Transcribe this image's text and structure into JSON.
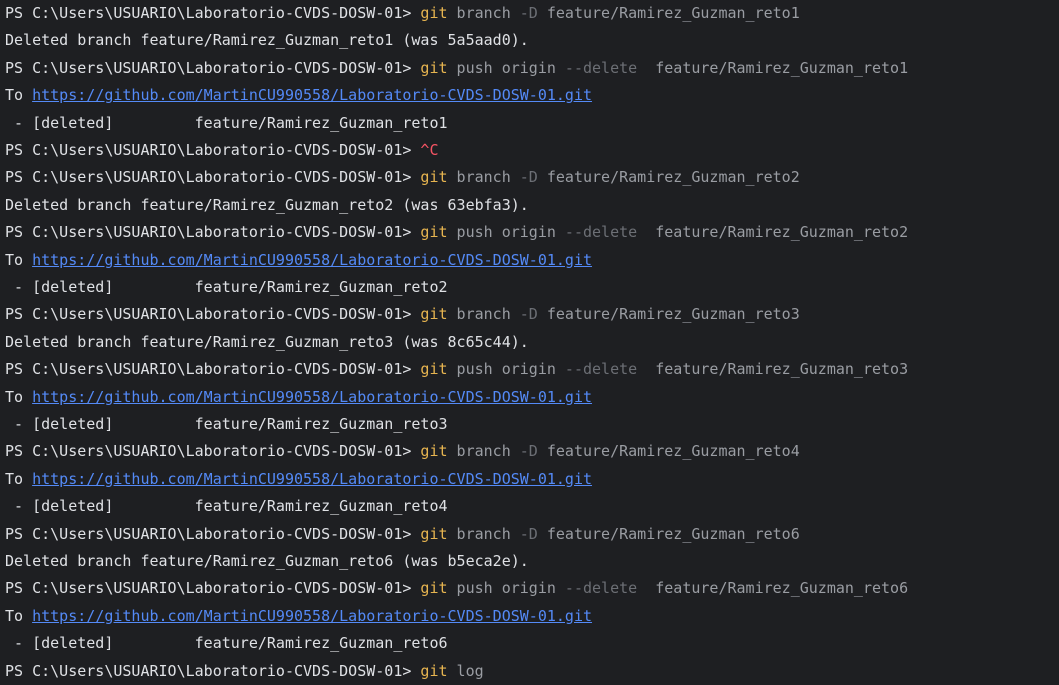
{
  "prompt": "PS C:\\Users\\USUARIO\\Laboratorio-CVDS-DOSW-01> ",
  "lines": [
    {
      "kind": "cmd",
      "cmd": "git",
      "args": [
        {
          "t": " branch ",
          "c": "arg"
        },
        {
          "t": "-D",
          "c": "flag"
        },
        {
          "t": " feature/Ramirez_Guzman_reto1",
          "c": "arg"
        }
      ]
    },
    {
      "kind": "out",
      "text": "Deleted branch feature/Ramirez_Guzman_reto1 (was 5a5aad0)."
    },
    {
      "kind": "cmd",
      "cmd": "git",
      "args": [
        {
          "t": " push origin ",
          "c": "arg"
        },
        {
          "t": "--delete",
          "c": "flag"
        },
        {
          "t": "  feature/Ramirez_Guzman_reto1",
          "c": "arg"
        }
      ]
    },
    {
      "kind": "to",
      "prefix": "To ",
      "url": "https://github.com/MartinCU990558/Laboratorio-CVDS-DOSW-01.git"
    },
    {
      "kind": "out",
      "text": " - [deleted]         feature/Ramirez_Guzman_reto1"
    },
    {
      "kind": "ctrlc",
      "text": "^C"
    },
    {
      "kind": "cmd",
      "cmd": "git",
      "args": [
        {
          "t": " branch ",
          "c": "arg"
        },
        {
          "t": "-D",
          "c": "flag"
        },
        {
          "t": " feature/Ramirez_Guzman_reto2",
          "c": "arg"
        }
      ]
    },
    {
      "kind": "out",
      "text": "Deleted branch feature/Ramirez_Guzman_reto2 (was 63ebfa3)."
    },
    {
      "kind": "cmd",
      "cmd": "git",
      "args": [
        {
          "t": " push origin ",
          "c": "arg"
        },
        {
          "t": "--delete",
          "c": "flag"
        },
        {
          "t": "  feature/Ramirez_Guzman_reto2",
          "c": "arg"
        }
      ]
    },
    {
      "kind": "to",
      "prefix": "To ",
      "url": "https://github.com/MartinCU990558/Laboratorio-CVDS-DOSW-01.git"
    },
    {
      "kind": "out",
      "text": " - [deleted]         feature/Ramirez_Guzman_reto2"
    },
    {
      "kind": "cmd",
      "cmd": "git",
      "args": [
        {
          "t": " branch ",
          "c": "arg"
        },
        {
          "t": "-D",
          "c": "flag"
        },
        {
          "t": " feature/Ramirez_Guzman_reto3",
          "c": "arg"
        }
      ]
    },
    {
      "kind": "out",
      "text": "Deleted branch feature/Ramirez_Guzman_reto3 (was 8c65c44)."
    },
    {
      "kind": "cmd",
      "cmd": "git",
      "args": [
        {
          "t": " push origin ",
          "c": "arg"
        },
        {
          "t": "--delete",
          "c": "flag"
        },
        {
          "t": "  feature/Ramirez_Guzman_reto3",
          "c": "arg"
        }
      ]
    },
    {
      "kind": "to",
      "prefix": "To ",
      "url": "https://github.com/MartinCU990558/Laboratorio-CVDS-DOSW-01.git"
    },
    {
      "kind": "out",
      "text": " - [deleted]         feature/Ramirez_Guzman_reto3"
    },
    {
      "kind": "cmd",
      "cmd": "git",
      "args": [
        {
          "t": " branch ",
          "c": "arg"
        },
        {
          "t": "-D",
          "c": "flag"
        },
        {
          "t": " feature/Ramirez_Guzman_reto4",
          "c": "arg"
        }
      ]
    },
    {
      "kind": "to",
      "prefix": "To ",
      "url": "https://github.com/MartinCU990558/Laboratorio-CVDS-DOSW-01.git"
    },
    {
      "kind": "out",
      "text": " - [deleted]         feature/Ramirez_Guzman_reto4"
    },
    {
      "kind": "cmd",
      "cmd": "git",
      "args": [
        {
          "t": " branch ",
          "c": "arg"
        },
        {
          "t": "-D",
          "c": "flag"
        },
        {
          "t": " feature/Ramirez_Guzman_reto6",
          "c": "arg"
        }
      ]
    },
    {
      "kind": "out",
      "text": "Deleted branch feature/Ramirez_Guzman_reto6 (was b5eca2e)."
    },
    {
      "kind": "cmd",
      "cmd": "git",
      "args": [
        {
          "t": " push origin ",
          "c": "arg"
        },
        {
          "t": "--delete",
          "c": "flag"
        },
        {
          "t": "  feature/Ramirez_Guzman_reto6",
          "c": "arg"
        }
      ]
    },
    {
      "kind": "to",
      "prefix": "To ",
      "url": "https://github.com/MartinCU990558/Laboratorio-CVDS-DOSW-01.git"
    },
    {
      "kind": "out",
      "text": " - [deleted]         feature/Ramirez_Guzman_reto6"
    },
    {
      "kind": "cmd",
      "cmd": "git",
      "args": [
        {
          "t": " log",
          "c": "arg"
        }
      ]
    }
  ],
  "colors": {
    "background": "#1e1f22",
    "text": "#dfe1e5",
    "command": "#e6b450",
    "argument": "#9a9da3",
    "flag": "#6c6f75",
    "interrupt": "#f75464",
    "link": "#548af7"
  }
}
